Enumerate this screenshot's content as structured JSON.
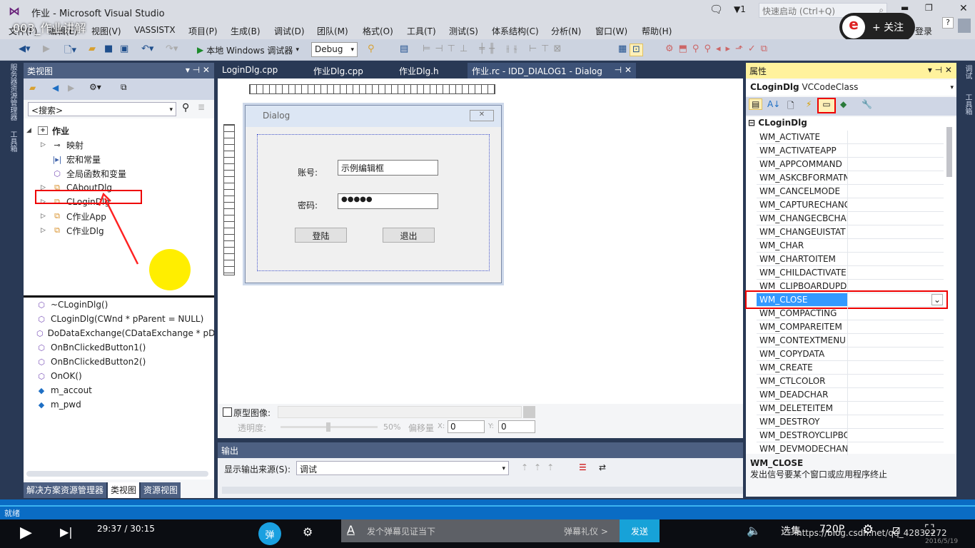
{
  "window": {
    "title": "作业 - Microsoft Visual Studio",
    "video_title": "003_作业讲解",
    "quick_launch_placeholder": "快速启动 (Ctrl+Q)",
    "notif_count": "1",
    "login": "登录",
    "follow": "+ 关注"
  },
  "menu": [
    "文件(F)",
    "编辑(E)",
    "视图(V)",
    "VASSISTX",
    "项目(P)",
    "生成(B)",
    "调试(D)",
    "团队(M)",
    "格式(O)",
    "工具(T)",
    "测试(S)",
    "体系结构(C)",
    "分析(N)",
    "窗口(W)",
    "帮助(H)"
  ],
  "toolbar": {
    "debugger": "本地 Windows 调试器",
    "config": "Debug"
  },
  "left_strip": {
    "items": [
      "服务器资源管理器",
      "工具箱"
    ]
  },
  "classview": {
    "title": "类视图",
    "search_placeholder": "<搜索>",
    "tree": [
      {
        "label": "作业",
        "icon": "project-icon"
      },
      {
        "label": "映射",
        "icon": "key-icon"
      },
      {
        "label": "宏和常量",
        "icon": "macro-icon"
      },
      {
        "label": "全局函数和变量",
        "icon": "global-icon"
      },
      {
        "label": "CAboutDlg",
        "icon": "class-icon"
      },
      {
        "label": "CLoginDlg",
        "icon": "class-icon",
        "highlighted": true
      },
      {
        "label": "C作业App",
        "icon": "class-icon"
      },
      {
        "label": "C作业Dlg",
        "icon": "class-icon"
      }
    ],
    "members": [
      "~CLoginDlg()",
      "CLoginDlg(CWnd * pParent = NULL)",
      "DoDataExchange(CDataExchange * pDX)",
      "OnBnClickedButton1()",
      "OnBnClickedButton2()",
      "OnOK()",
      "m_accout",
      "m_pwd"
    ],
    "bottom_tabs": [
      "解决方案资源管理器",
      "类视图",
      "资源视图"
    ]
  },
  "editor": {
    "tabs": [
      "LoginDlg.cpp",
      "作业Dlg.cpp",
      "作业Dlg.h",
      "作业.rc - IDD_DIALOG1 - Dialog"
    ],
    "active_tab": 3,
    "dialog": {
      "title": "Dialog",
      "account_label": "账号:",
      "account_value": "示例编辑框",
      "password_label": "密码:",
      "password_value": "●●●●●",
      "login_button": "登陆",
      "exit_button": "退出"
    },
    "prototype": {
      "label": "原型图像:",
      "opacity_label": "透明度:",
      "opacity": "50%",
      "offset_label": "偏移量",
      "x_label": "X:",
      "x_value": "0",
      "y_label": "Y:",
      "y_value": "0"
    }
  },
  "output": {
    "title": "输出",
    "source_label": "显示输出来源(S):",
    "source_value": "调试"
  },
  "properties": {
    "title": "属性",
    "object": "CLoginDlg",
    "object_type": "VCCodeClass",
    "category": "CLoginDlg",
    "messages": [
      "WM_ACTIVATE",
      "WM_ACTIVATEAPP",
      "WM_APPCOMMAND",
      "WM_ASKCBFORMATN",
      "WM_CANCELMODE",
      "WM_CAPTURECHANG",
      "WM_CHANGECBCHAI",
      "WM_CHANGEUISTAT",
      "WM_CHAR",
      "WM_CHARTOITEM",
      "WM_CHILDACTIVATE",
      "WM_CLIPBOARDUPD",
      "WM_CLOSE",
      "WM_COMPACTING",
      "WM_COMPAREITEM",
      "WM_CONTEXTMENU",
      "WM_COPYDATA",
      "WM_CREATE",
      "WM_CTLCOLOR",
      "WM_DEADCHAR",
      "WM_DELETEITEM",
      "WM_DESTROY",
      "WM_DESTROYCLIPBO",
      "WM_DEVMODECHAN"
    ],
    "selected": "WM_CLOSE",
    "desc_title": "WM_CLOSE",
    "desc_text": "发出信号要某个窗口或应用程序终止"
  },
  "right_strip": {
    "items": [
      "调试",
      "工具箱"
    ]
  },
  "status": {
    "text": "就绪"
  },
  "player": {
    "time": "29:37 / 30:15",
    "danmaku_placeholder": "发个弹幕见证当下",
    "danmaku_gift": "弹幕礼仪 >",
    "send": "发送",
    "episodes": "选集",
    "quality": "720P",
    "danmaku_badge": "弹",
    "watermark": "https://blog.csdn.net/qq_42832272",
    "date": "2016/5/19"
  },
  "colors": {
    "accent": "#007acc",
    "highlight_box": "#ee0000",
    "properties_header": "#fff29d",
    "selected_row": "#3399ff"
  }
}
